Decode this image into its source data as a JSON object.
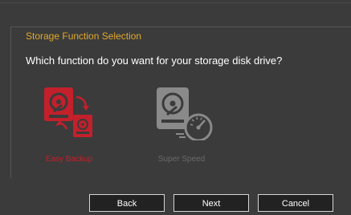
{
  "dialog": {
    "title": "Storage Function Selection",
    "question": "Which function do you want for your storage disk drive?"
  },
  "options": [
    {
      "label": "Easy Backup",
      "icon": "easy-backup-icon",
      "selected": true,
      "color": "#c3202c"
    },
    {
      "label": "Super Speed",
      "icon": "super-speed-icon",
      "selected": false,
      "color": "#6a6a6a"
    }
  ],
  "buttons": {
    "back": "Back",
    "next": "Next",
    "cancel": "Cancel"
  },
  "colors": {
    "title": "#e0a82e",
    "accent": "#c3202c",
    "background": "#3b3b3b"
  }
}
